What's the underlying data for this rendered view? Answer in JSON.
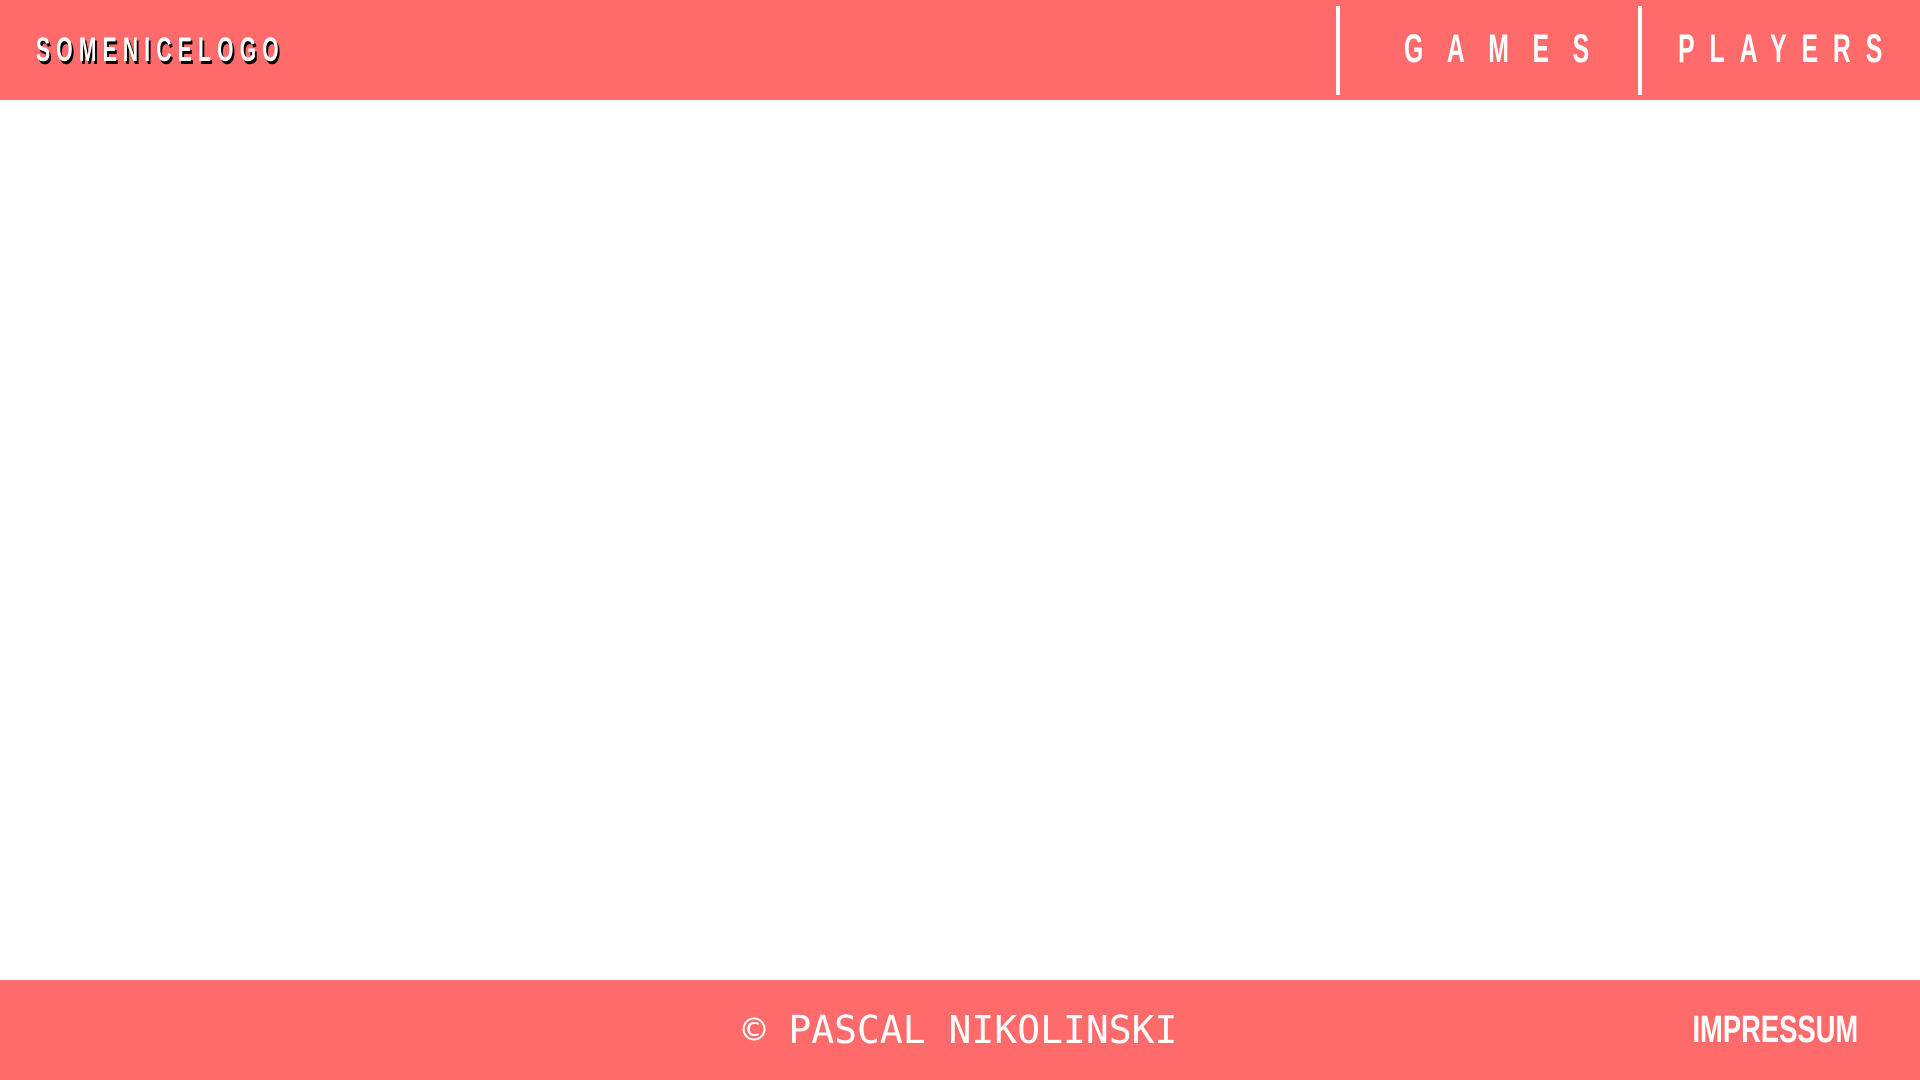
{
  "header": {
    "logo_text": "SOMENICELOGO",
    "nav": [
      {
        "label": "GAMES"
      },
      {
        "label": "PLAYERS"
      }
    ]
  },
  "footer": {
    "copyright": "© PASCAL NIKOLINSKI",
    "impressum_label": "IMPRESSUM"
  },
  "colors": {
    "brand": "#ff6b6b",
    "text": "#ffffff",
    "logo_shadow": "#000000",
    "background": "#ffffff"
  }
}
